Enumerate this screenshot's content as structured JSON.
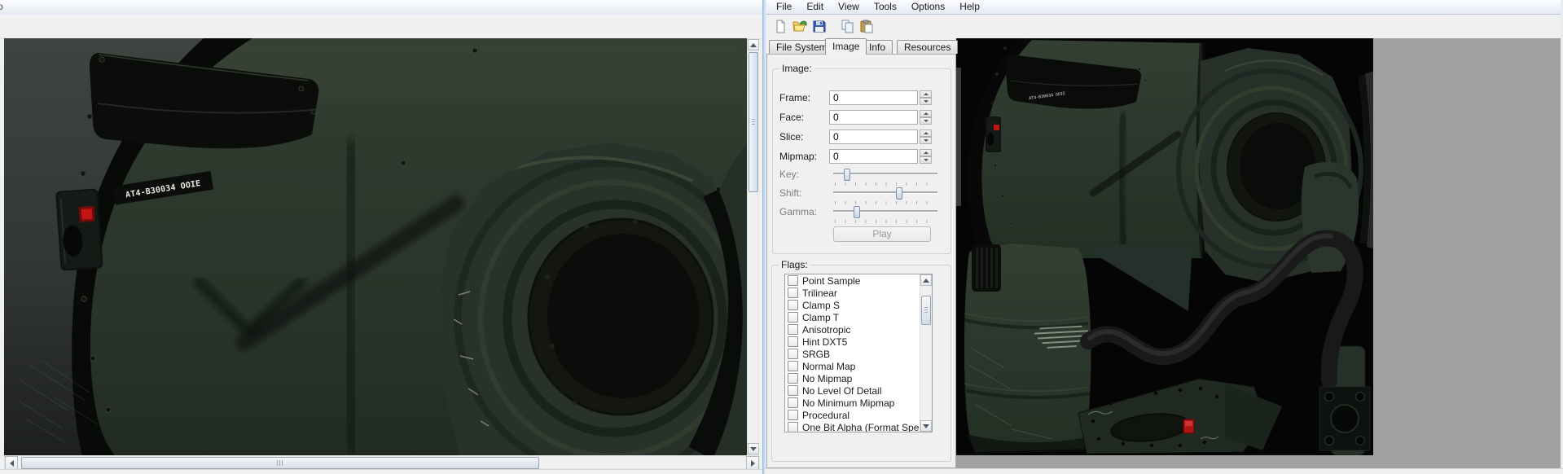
{
  "left_window": {
    "partial_menu_char": "o"
  },
  "right_window": {
    "menu_items": [
      "File",
      "Edit",
      "View",
      "Tools",
      "Options",
      "Help"
    ],
    "toolbar_icons": [
      "new-document",
      "open-folder",
      "save",
      "copy",
      "paste"
    ],
    "tabs": [
      "File System",
      "Image",
      "Info",
      "Resources"
    ],
    "active_tab": "Image",
    "image_group": {
      "title": "Image:",
      "fields": [
        {
          "label": "Frame:",
          "value": "0"
        },
        {
          "label": "Face:",
          "value": "0"
        },
        {
          "label": "Slice:",
          "value": "0"
        },
        {
          "label": "Mipmap:",
          "value": "0"
        }
      ],
      "sliders": [
        {
          "label": "Key:",
          "percent": 13
        },
        {
          "label": "Shift:",
          "percent": 63
        },
        {
          "label": "Gamma:",
          "percent": 23
        }
      ],
      "play_label": "Play"
    },
    "flags_group": {
      "title": "Flags:",
      "items": [
        "Point Sample",
        "Trilinear",
        "Clamp S",
        "Clamp T",
        "Anisotropic",
        "Hint DXT5",
        "SRGB",
        "Normal Map",
        "No Mipmap",
        "No Level Of Detail",
        "No Minimum Mipmap",
        "Procedural",
        "One Bit Alpha (Format Spec"
      ],
      "checked": []
    }
  },
  "texture": {
    "stencil_label": "AT4-B30034 OOIE"
  },
  "colors": {
    "accent_red": "#c41414",
    "body_green": "#2d382e",
    "viewer_background": "#a2a2a2"
  }
}
